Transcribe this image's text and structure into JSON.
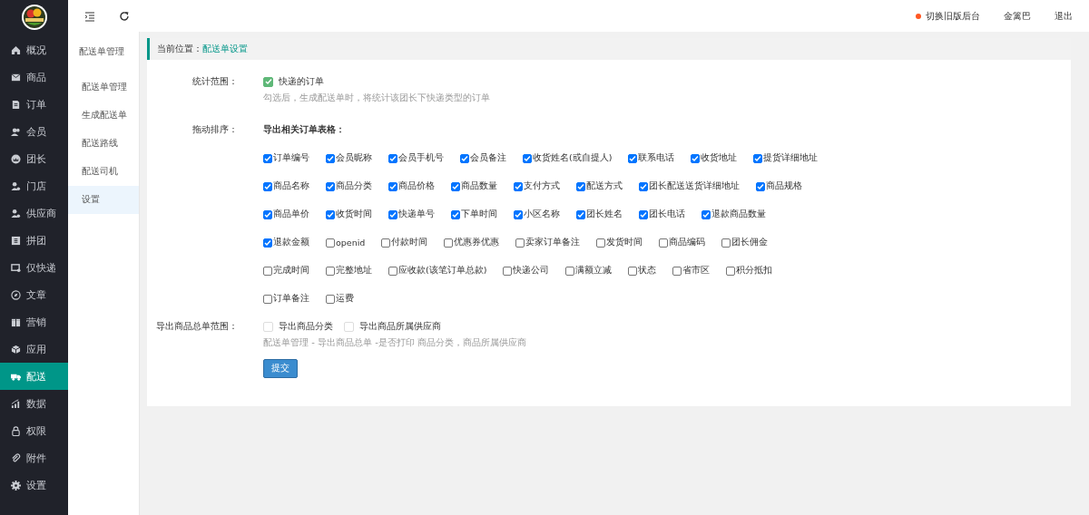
{
  "topbar": {
    "switch_link": "切换旧版后台",
    "user": "金篱巴",
    "logout": "退出"
  },
  "nav": [
    {
      "label": "概况",
      "selected": false
    },
    {
      "label": "商品",
      "selected": false
    },
    {
      "label": "订单",
      "selected": false
    },
    {
      "label": "会员",
      "selected": false
    },
    {
      "label": "团长",
      "selected": false
    },
    {
      "label": "门店",
      "selected": false
    },
    {
      "label": "供应商",
      "selected": false
    },
    {
      "label": "拼团",
      "selected": false
    },
    {
      "label": "仅快递",
      "selected": false
    },
    {
      "label": "文章",
      "selected": false
    },
    {
      "label": "营销",
      "selected": false
    },
    {
      "label": "应用",
      "selected": false
    },
    {
      "label": "配送",
      "selected": true
    },
    {
      "label": "数据",
      "selected": false
    },
    {
      "label": "权限",
      "selected": false
    },
    {
      "label": "附件",
      "selected": false
    },
    {
      "label": "设置",
      "selected": false
    }
  ],
  "subnav": {
    "title": "配送单管理",
    "items": [
      {
        "label": "配送单管理",
        "selected": false
      },
      {
        "label": "生成配送单",
        "selected": false
      },
      {
        "label": "配送路线",
        "selected": false
      },
      {
        "label": "配送司机",
        "selected": false
      },
      {
        "label": "设置",
        "selected": true
      }
    ]
  },
  "breadcrumb": {
    "prefix": "当前位置：",
    "current": "配送单设置"
  },
  "form": {
    "scope": {
      "label": "统计范围：",
      "option": "快递的订单",
      "checked": true,
      "hint": "勾选后，生成配送单时，将统计该团长下快递类型的订单"
    },
    "sort": {
      "label": "拖动排序：",
      "heading": "导出相关订单表格：",
      "fields": [
        {
          "label": "订单编号",
          "checked": true
        },
        {
          "label": "会员昵称",
          "checked": true
        },
        {
          "label": "会员手机号",
          "checked": true
        },
        {
          "label": "会员备注",
          "checked": true
        },
        {
          "label": "收货姓名(或自提人)",
          "checked": true
        },
        {
          "label": "联系电话",
          "checked": true
        },
        {
          "label": "收货地址",
          "checked": true
        },
        {
          "label": "提货详细地址",
          "checked": true
        },
        {
          "label": "商品名称",
          "checked": true
        },
        {
          "label": "商品分类",
          "checked": true
        },
        {
          "label": "商品价格",
          "checked": true
        },
        {
          "label": "商品数量",
          "checked": true
        },
        {
          "label": "支付方式",
          "checked": true
        },
        {
          "label": "配送方式",
          "checked": true
        },
        {
          "label": "团长配送送货详细地址",
          "checked": true
        },
        {
          "label": "商品规格",
          "checked": true
        },
        {
          "label": "商品单价",
          "checked": true
        },
        {
          "label": "收货时间",
          "checked": true
        },
        {
          "label": "快递单号",
          "checked": true
        },
        {
          "label": "下单时间",
          "checked": true
        },
        {
          "label": "小区名称",
          "checked": true
        },
        {
          "label": "团长姓名",
          "checked": true
        },
        {
          "label": "团长电话",
          "checked": true
        },
        {
          "label": "退款商品数量",
          "checked": true
        },
        {
          "label": "退款金额",
          "checked": true
        },
        {
          "label": "openid",
          "checked": false
        },
        {
          "label": "付款时间",
          "checked": false
        },
        {
          "label": "优惠券优惠",
          "checked": false
        },
        {
          "label": "卖家订单备注",
          "checked": false
        },
        {
          "label": "发货时间",
          "checked": false
        },
        {
          "label": "商品编码",
          "checked": false
        },
        {
          "label": "团长佣金",
          "checked": false
        },
        {
          "label": "完成时间",
          "checked": false
        },
        {
          "label": "完整地址",
          "checked": false
        },
        {
          "label": "应收款(该笔订单总款)",
          "checked": false
        },
        {
          "label": "快递公司",
          "checked": false
        },
        {
          "label": "满额立减",
          "checked": false
        },
        {
          "label": "状态",
          "checked": false
        },
        {
          "label": "省市区",
          "checked": false
        },
        {
          "label": "积分抵扣",
          "checked": false
        },
        {
          "label": "订单备注",
          "checked": false
        },
        {
          "label": "运费",
          "checked": false
        }
      ]
    },
    "export": {
      "label": "导出商品总单范围：",
      "options": [
        {
          "label": "导出商品分类",
          "checked": false
        },
        {
          "label": "导出商品所属供应商",
          "checked": false
        }
      ],
      "hint": "配送单管理 - 导出商品总单 -是否打印 商品分类，商品所属供应商"
    },
    "submit": "提交"
  }
}
